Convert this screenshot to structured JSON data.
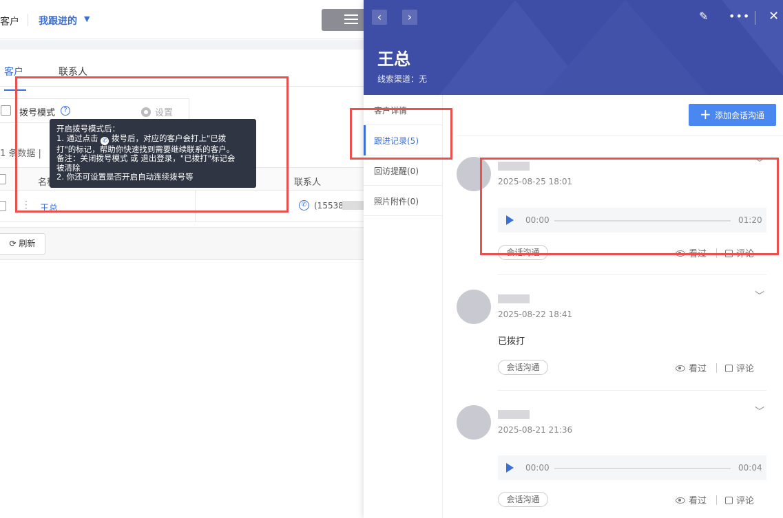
{
  "top_bar": {
    "crumb": "客户",
    "scope": "我跟进的"
  },
  "tabs": [
    {
      "label": "客户"
    },
    {
      "label": "联系人"
    }
  ],
  "dial_mode": {
    "label": "拨号模式",
    "settings_label": "设置"
  },
  "tooltip": {
    "line1": "开启拨号模式后：",
    "line2a": "1. 通过点击",
    "line2b": "拨号后，对应的客户会打上\"已拨",
    "line3": "打\"的标记，帮助你快速找到需要继续联系的客户。",
    "line4": "备注：关闭拨号模式 或 退出登录，\"已拨打\"标记会",
    "line5": "被清除",
    "line6": "2. 你还可设置是否开启自动连续拨号等"
  },
  "list": {
    "count_text": "1 条数据 |",
    "columns": {
      "name": "名称",
      "contact": "联系人"
    },
    "row": {
      "name": "王总",
      "phone": "(155383"
    },
    "refresh_label": "刷新"
  },
  "drawer": {
    "title": "王总",
    "subtitle": "线索渠道：无",
    "nav": [
      {
        "label": "客户详情"
      },
      {
        "label": "跟进记录(5)"
      },
      {
        "label": "回访提醒(0)"
      },
      {
        "label": "照片附件(0)"
      }
    ],
    "add_button": "添加会话沟通",
    "records": [
      {
        "time": "2025-08-25 18:01",
        "audio_current": "00:00",
        "audio_duration": "01:20",
        "tag": "会话沟通",
        "seen": "看过",
        "comment": "评论"
      },
      {
        "time": "2025-08-22 18:41",
        "text": "已拨打",
        "tag": "会话沟通",
        "seen": "看过",
        "comment": "评论"
      },
      {
        "time": "2025-08-21 21:36",
        "audio_current": "00:00",
        "audio_duration": "00:04",
        "tag": "会话沟通",
        "seen": "看过",
        "comment": "评论"
      }
    ]
  },
  "colors": {
    "accent": "#3a6fd8",
    "header": "#3e4ea7",
    "highlight_box": "#e9504e",
    "tooltip_bg": "#2f3542",
    "primary_button": "#4b87f0"
  },
  "icons": [
    "list-view-icon",
    "chevron-down-icon",
    "question-icon",
    "gear-icon",
    "phone-icon",
    "refresh-icon",
    "chevron-left-icon",
    "chevron-right-icon",
    "edit-icon",
    "more-icon",
    "close-icon",
    "plus-icon",
    "play-icon",
    "eye-icon",
    "comment-icon"
  ]
}
